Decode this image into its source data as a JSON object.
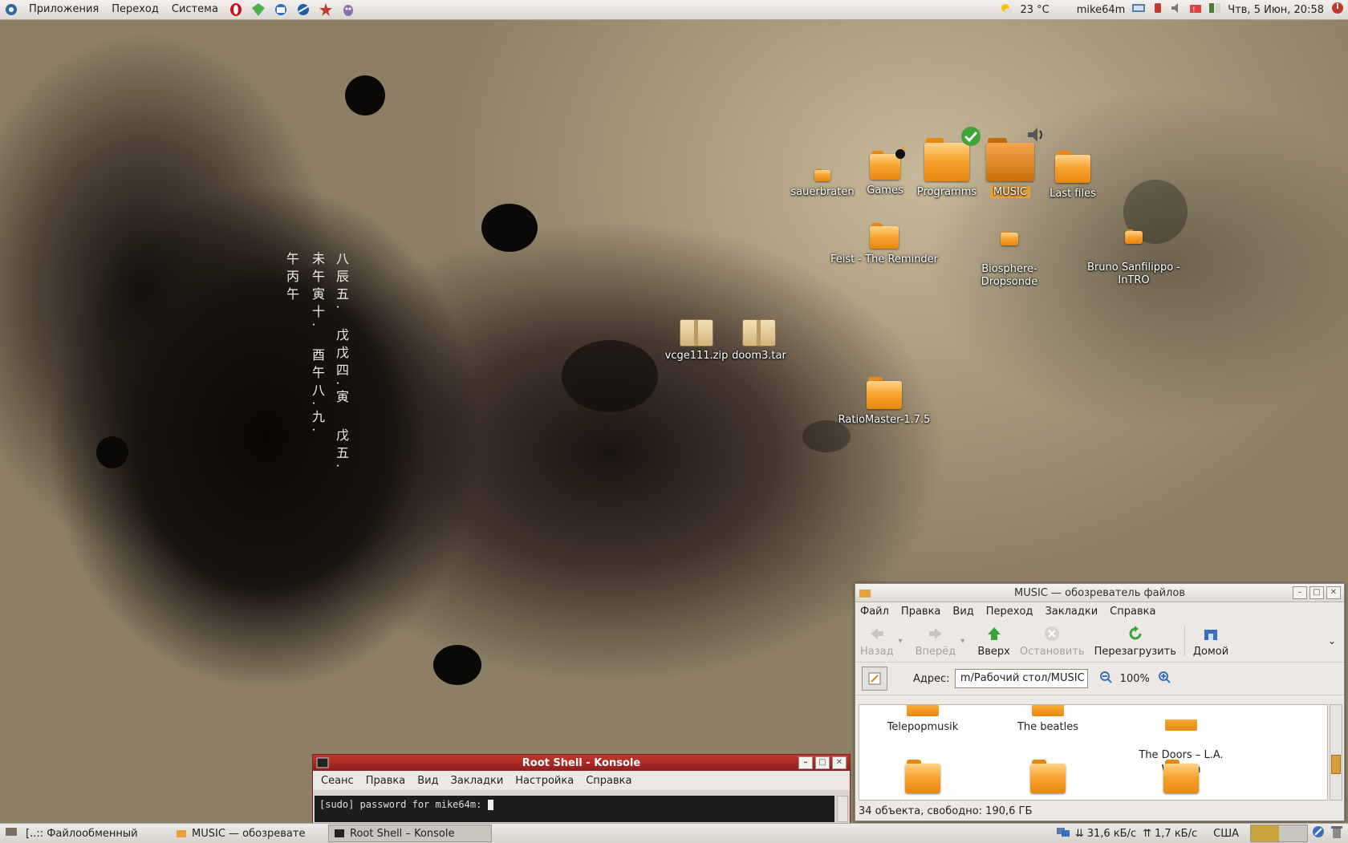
{
  "top_panel": {
    "menus": [
      "Приложения",
      "Переход",
      "Система"
    ],
    "launchers": [
      "opera-icon",
      "gem-icon",
      "thunderbird-icon",
      "network-icon",
      "star-icon",
      "pidgin-icon"
    ],
    "weather": "23 °C",
    "user": "mike64m",
    "clock": "Чтв, 5 Июн, 20:58"
  },
  "desktop": {
    "icons": [
      {
        "label": "sauerbraten"
      },
      {
        "label": "Games"
      },
      {
        "label": "Programms"
      },
      {
        "label": "MUSIC"
      },
      {
        "label": "Last files"
      },
      {
        "label": "Feist - The Reminder"
      },
      {
        "label": "Biosphere-\nDropsonde"
      },
      {
        "label": "Bruno Sanfilippo -\nInTRO"
      },
      {
        "label": "vcge111.zip"
      },
      {
        "label": "doom3.tar"
      },
      {
        "label": "RatioMaster-1.7.5"
      }
    ]
  },
  "file_manager": {
    "title": "MUSIC — обозреватель файлов",
    "menu": [
      "Файл",
      "Правка",
      "Вид",
      "Переход",
      "Закладки",
      "Справка"
    ],
    "toolbar": {
      "back": "Назад",
      "forward": "Вперёд",
      "up": "Вверх",
      "stop": "Остановить",
      "reload": "Перезагрузить",
      "home": "Домой"
    },
    "address_label": "Адрес:",
    "address_value": "m/Рабочий стол/MUSIC",
    "zoom": "100%",
    "items": [
      "Telepopmusik",
      "The beatles",
      "The Doors – L.A.\nWoman"
    ],
    "status": "34 объекта, свободно: 190,6 ГБ"
  },
  "konsole": {
    "title": "Root Shell - Konsole",
    "menu": [
      "Сеанс",
      "Правка",
      "Вид",
      "Закладки",
      "Настройка",
      "Справка"
    ],
    "prompt": "[sudo] password for mike64m: "
  },
  "bottom_panel": {
    "tasks": [
      "[..:: Файлообменный",
      "MUSIC — обозревате",
      "Root Shell – Konsole"
    ],
    "net_down": "31,6 кБ/с",
    "net_up": "1,7 кБ/с",
    "layout": "США"
  }
}
